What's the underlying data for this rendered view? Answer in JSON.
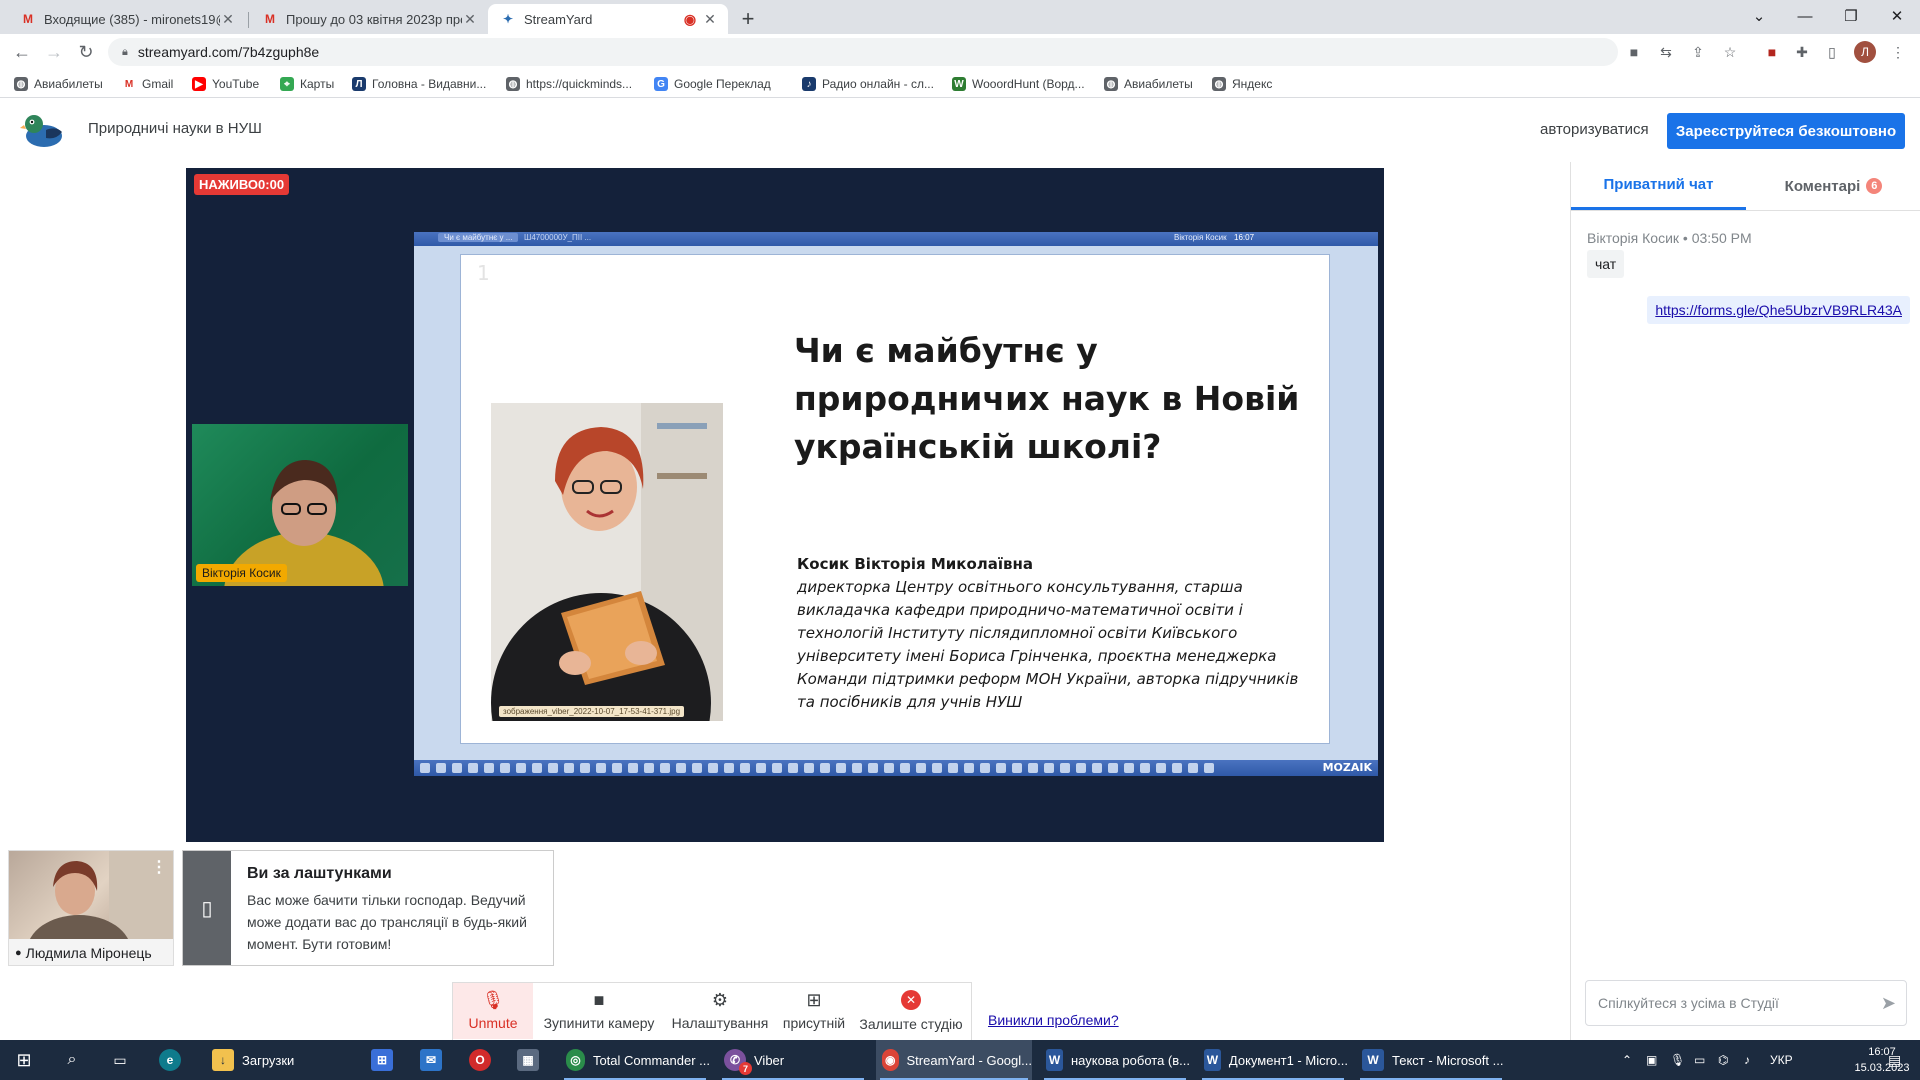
{
  "browser": {
    "tabs": [
      {
        "label": "Входящие (385) - mironets19@g",
        "icon": "gmail-icon"
      },
      {
        "label": "Прошу до 03 квітня 2023р прос",
        "icon": "gmail-icon"
      },
      {
        "label": "StreamYard",
        "icon": "streamyard-icon"
      }
    ],
    "url": "streamyard.com/7b4zguph8e",
    "bookmarks": [
      "Авиабилеты",
      "Gmail",
      "YouTube",
      "Карты",
      "Головна - Видавни...",
      "https://quickminds...",
      "Google Переклад",
      "Радио онлайн - сл...",
      "WooordHunt (Ворд...",
      "Авиабилеты",
      "Яндекс"
    ],
    "profile_initial": "Л"
  },
  "header": {
    "show_title": "Природничі науки в НУШ",
    "login": "авторизуватися",
    "signup": "Зареєструйтеся безкоштовно"
  },
  "stage": {
    "live_badge": "НАЖИВО0:00",
    "participant_name": "Вікторія Косик",
    "shared_screen": {
      "top_tabs": [
        "Чи є майбутнє у ...",
        "Ш4700000У_ПІІ ..."
      ],
      "top_user": "Вікторія Косик",
      "top_time": "16:07",
      "toolbar_brand": "MOZAIK",
      "slide": {
        "number": "1",
        "title": "Чи є майбутнє у природничих наук в Новій українській школі?",
        "name": "Косик Вікторія Миколаївна",
        "bio": "директорка Центру освітнього консультування, старша викладачка кафедри природничо-математичної освіти і технологій Інституту післядипломної освіти Київського університету імені Бориса Грінченка, проєктна менеджерка Команди підтримки реформ МОН України, авторка підручників та посібників для учнів НУШ",
        "photo_caption": "зображення_viber_2022-10-07_17-53-41-371.jpg"
      }
    }
  },
  "backstage": {
    "self_name": "Людмила Міронець",
    "card_title": "Ви за лаштунками",
    "card_text": "Вас може бачити тільки господар. Ведучий може додати вас до трансляції в будь-який момент. Бути готовим!"
  },
  "controls": {
    "unmute": "Unmute",
    "stop_camera": "Зупинити камеру",
    "settings": "Налаштування",
    "present": "присутній",
    "leave": "Залиште студію",
    "problems": "Виникли проблеми?"
  },
  "chat": {
    "tab_private": "Приватний чат",
    "tab_comments": "Коментарі",
    "comments_count": "6",
    "message_author": "Вікторія Косик",
    "message_time": "03:50 PM",
    "message_text": "чат",
    "link_text": "https://forms.gle/Qhe5UbzrVB9RLR43A",
    "input_placeholder": "Спілкуйтеся з усіма в Студії"
  },
  "taskbar": {
    "items": [
      {
        "label": "Загрузки",
        "icon": "download-folder-icon"
      },
      {
        "label": "Total Commander ...",
        "icon": "total-commander-icon"
      },
      {
        "label": "Viber",
        "icon": "viber-icon"
      },
      {
        "label": "StreamYard - Googl...",
        "icon": "chrome-icon"
      },
      {
        "label": "наукова робота (в...",
        "icon": "word-icon"
      },
      {
        "label": "Документ1 - Micro...",
        "icon": "word-icon"
      },
      {
        "label": "Текст - Microsoft ...",
        "icon": "word-icon"
      }
    ],
    "language": "УКР",
    "time": "16:07",
    "date": "15.03.2023",
    "viber_badge": "7"
  },
  "colors": {
    "accent": "#1a73e8",
    "live": "#e53935",
    "stage_bg": "#14213a",
    "taskbar": "#1c2b3f"
  }
}
